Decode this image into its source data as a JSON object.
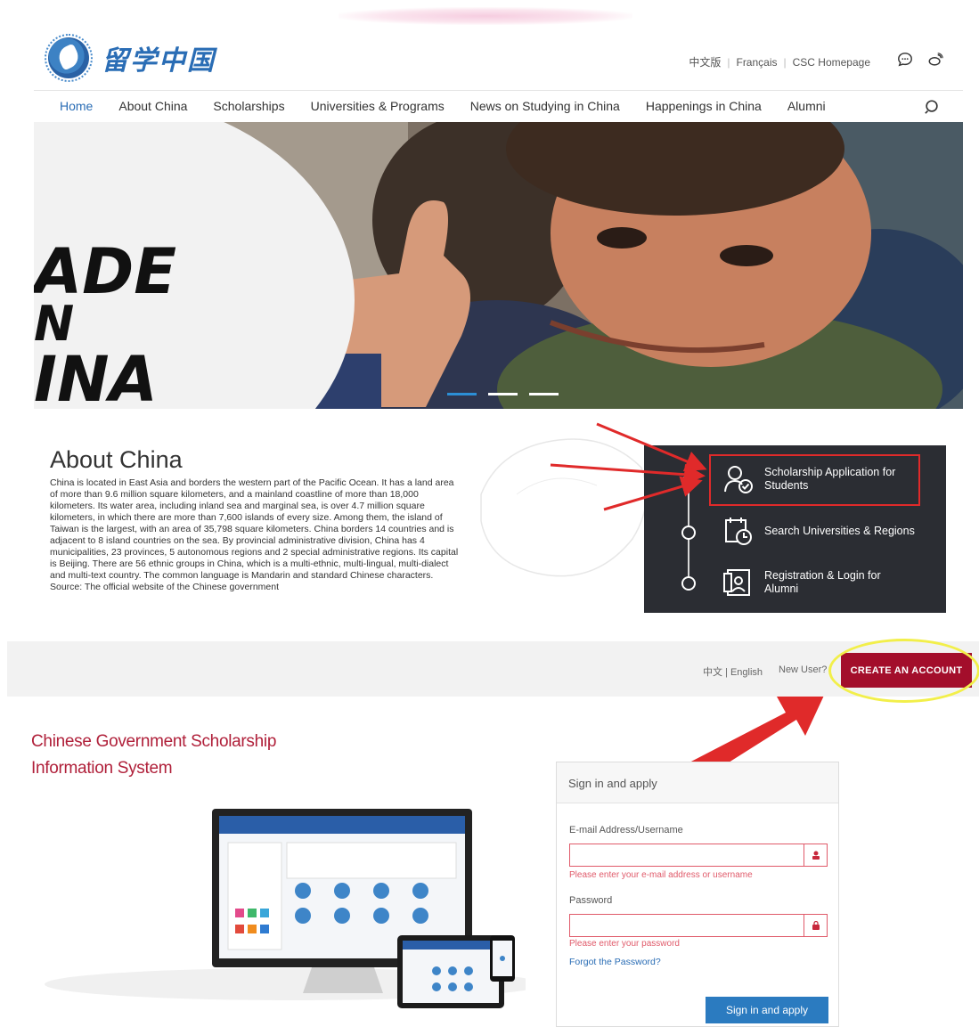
{
  "site": {
    "logo_text": "留学中国",
    "utility_links": [
      "中文版",
      "Français",
      "CSC Homepage"
    ],
    "icons": [
      "chat-bubble-icon",
      "weibo-icon"
    ]
  },
  "nav": {
    "items": [
      "Home",
      "About China",
      "Scholarships",
      "Universities & Programs",
      "News on Studying in China",
      "Happenings in China",
      "Alumni"
    ],
    "active": "Home"
  },
  "hero": {
    "plate_text": [
      "ADE",
      "N",
      "INA"
    ],
    "slides": 3,
    "active_slide": 1
  },
  "about": {
    "title": "About China",
    "text": "China is located in East Asia and borders the western part of the Pacific Ocean. It has a land area of more than 9.6 million square kilometers, and a mainland coastline of more than 18,000 kilometers. Its water area, including inland sea and marginal sea, is over 4.7 million square kilometers, in which there are more than 7,600 islands of every size. Among them, the island of Taiwan is the largest, with an area of 35,798 square kilometers. China borders 14 countries and is adjacent to 8 island countries on the sea. By provincial administrative division, China has 4 municipalities, 23 provinces, 5 autonomous regions and 2 special administrative regions. Its capital is Beijing. There are 56 ethnic groups in China, which is a multi-ethnic, multi-lingual, multi-dialect and multi-text country. The common language is Mandarin and standard Chinese characters.",
    "source": "Source: The official website of the Chinese government"
  },
  "panel": {
    "entries": [
      {
        "label": "Scholarship Application for Students",
        "icon": "student-check-icon"
      },
      {
        "label": "Search Universities & Regions",
        "icon": "calendar-clock-icon"
      },
      {
        "label": "Registration & Login for Alumni",
        "icon": "id-card-icon"
      }
    ]
  },
  "csc": {
    "lang": "中文 | English",
    "new_user": "New User?",
    "create_account": "CREATE AN ACCOUNT",
    "title_line1": "Chinese Government Scholarship",
    "title_line2": "Information System"
  },
  "signin": {
    "heading": "Sign in and apply",
    "email_label": "E-mail Address/Username",
    "email_error": "Please enter your e-mail address or username",
    "password_label": "Password",
    "password_error": "Please enter your password",
    "forgot": "Forgot the Password?",
    "button": "Sign in and apply"
  },
  "colors": {
    "brand_blue": "#2a6db5",
    "csc_red": "#a30e2b",
    "error_red": "#e05a6a",
    "annotation_red": "#e02a2a",
    "annotation_yellow": "#f2ef4a"
  }
}
